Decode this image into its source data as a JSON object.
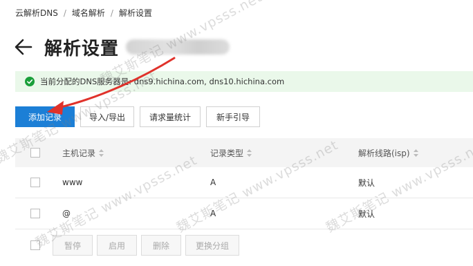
{
  "breadcrumb": {
    "items": [
      "云解析DNS",
      "域名解析",
      "解析设置"
    ],
    "separator": "/"
  },
  "page": {
    "title": "解析设置",
    "back_icon": "arrow-left-icon"
  },
  "notice": {
    "icon": "check-circle-icon",
    "text": "当前分配的DNS服务器是: dns9.hichina.com, dns10.hichina.com",
    "color": "#eaf8ea"
  },
  "toolbar": {
    "buttons": [
      "添加记录",
      "导入/导出",
      "请求量统计",
      "新手引导"
    ],
    "primary_color": "#1c7fd6"
  },
  "table": {
    "columns": [
      "主机记录",
      "记录类型",
      "解析线路(isp)"
    ],
    "rows": [
      {
        "host": "www",
        "type": "A",
        "line": "默认"
      },
      {
        "host": "@",
        "type": "A",
        "line": "默认"
      }
    ]
  },
  "footer": {
    "buttons": [
      "暂停",
      "启用",
      "删除",
      "更换分组"
    ]
  },
  "watermark": {
    "text": "魏艾斯笔记 www.vpsss.net"
  }
}
